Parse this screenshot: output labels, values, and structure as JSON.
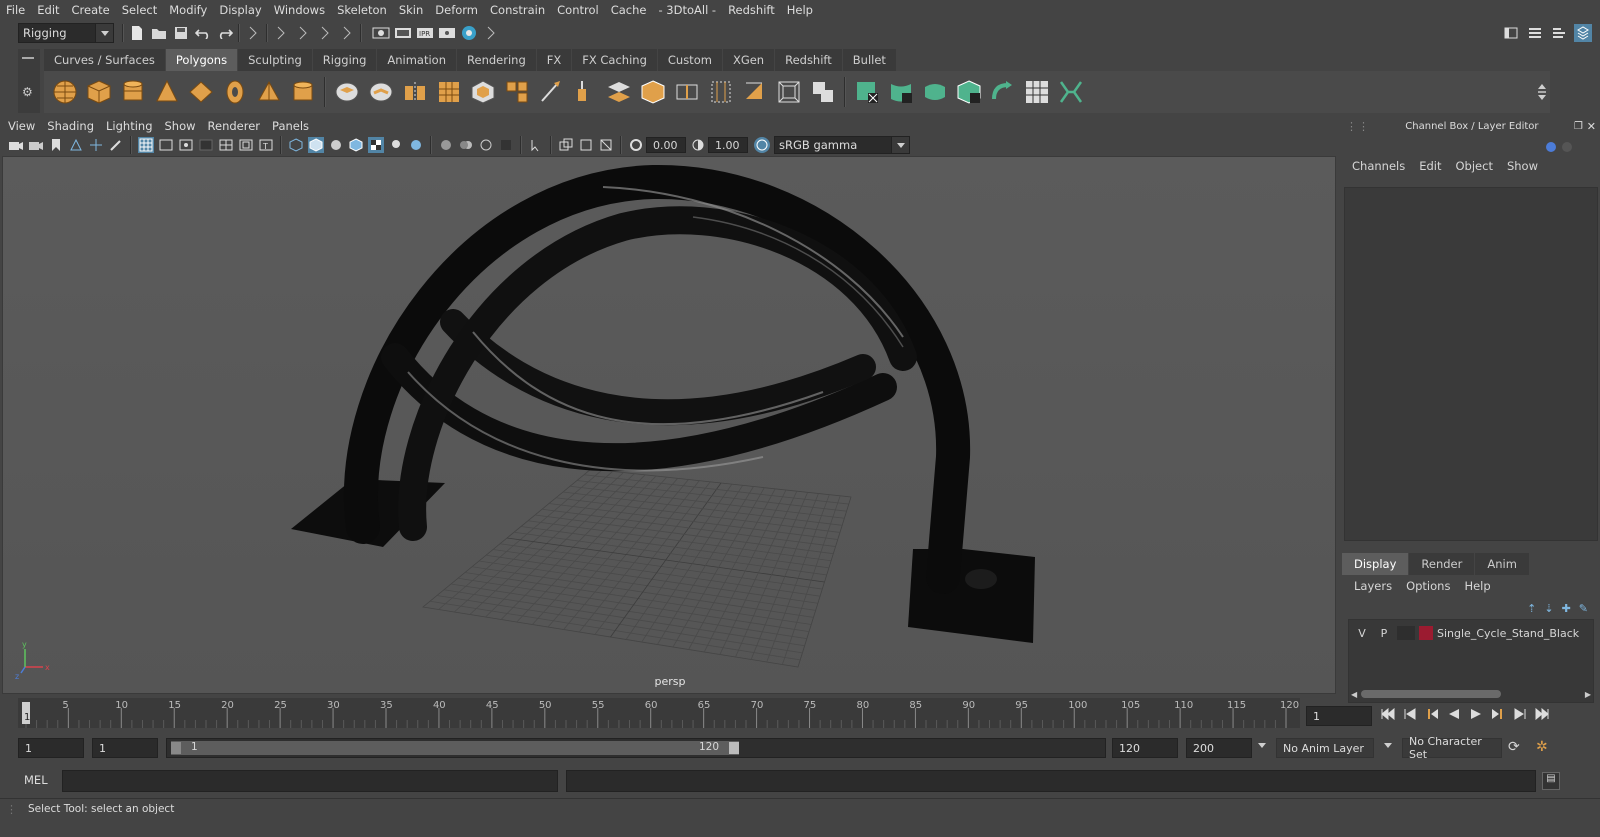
{
  "menubar": [
    "File",
    "Edit",
    "Create",
    "Select",
    "Modify",
    "Display",
    "Windows",
    "Skeleton",
    "Skin",
    "Deform",
    "Constrain",
    "Control",
    "Cache",
    "- 3DtoAll -",
    "Redshift",
    "Help"
  ],
  "statusline": {
    "menu_set": "Rigging"
  },
  "shelf": {
    "tabs": [
      "Curves / Surfaces",
      "Polygons",
      "Sculpting",
      "Rigging",
      "Animation",
      "Rendering",
      "FX",
      "FX Caching",
      "Custom",
      "XGen",
      "Redshift",
      "Bullet"
    ],
    "active_tab": "Polygons"
  },
  "viewport": {
    "menus": [
      "View",
      "Shading",
      "Lighting",
      "Show",
      "Renderer",
      "Panels"
    ],
    "exposure": "0.00",
    "gamma": "1.00",
    "color_space": "sRGB gamma",
    "camera_label": "persp",
    "axis": {
      "x": "x",
      "y": "y",
      "z": "z"
    }
  },
  "channel_box": {
    "title": "Channel Box / Layer Editor",
    "menus": [
      "Channels",
      "Edit",
      "Object",
      "Show"
    ]
  },
  "layer_editor": {
    "tabs": [
      "Display",
      "Render",
      "Anim"
    ],
    "active_tab": "Display",
    "menus": [
      "Layers",
      "Options",
      "Help"
    ],
    "layer": {
      "v": "V",
      "p": "P",
      "name": "Single_Cycle_Stand_Black",
      "color": "#9b1b30"
    }
  },
  "timeline": {
    "ticks": [
      "5",
      "10",
      "15",
      "20",
      "25",
      "30",
      "35",
      "40",
      "45",
      "50",
      "55",
      "60",
      "65",
      "70",
      "75",
      "80",
      "85",
      "90",
      "95",
      "100",
      "105",
      "110",
      "115",
      "120"
    ],
    "start_label": "1",
    "current_frame": "1"
  },
  "range": {
    "start": "1",
    "playback_start": "1",
    "slider_start": "1",
    "slider_end": "120",
    "playback_end": "120",
    "end": "200",
    "anim_layer": "No Anim Layer",
    "character_set": "No Character Set"
  },
  "command": {
    "label": "MEL"
  },
  "help_line": "Select Tool: select an object",
  "colors": {
    "accent": "#5285a6",
    "shelf_green": "#4fb38d",
    "shelf_orange": "#e0a04a"
  }
}
